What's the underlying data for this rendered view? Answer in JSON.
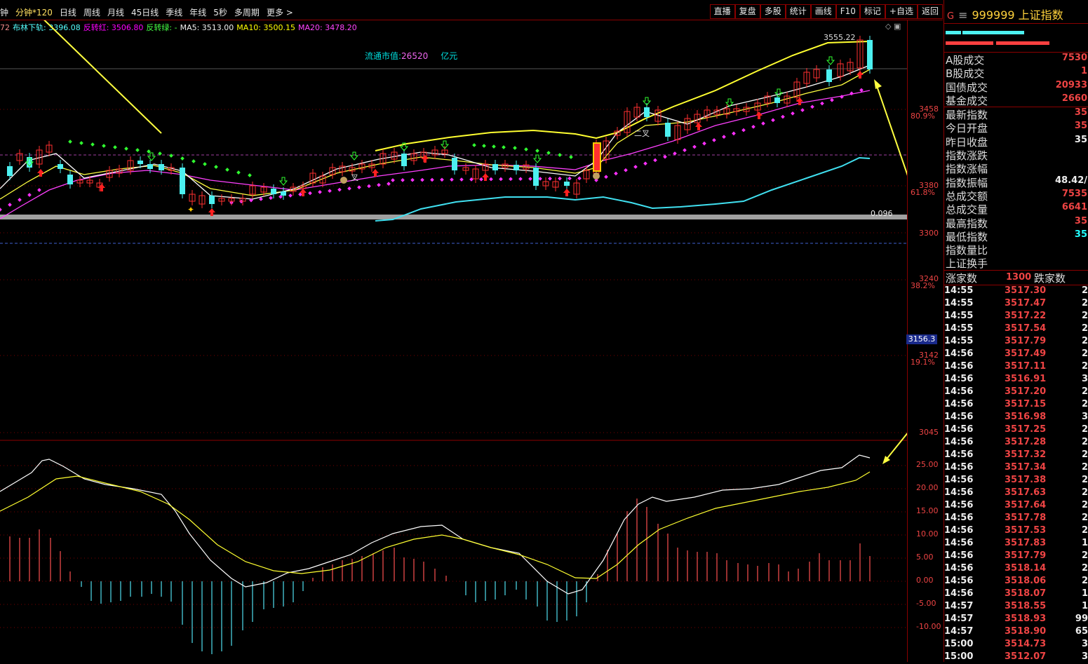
{
  "tabs": [
    {
      "label": "钟",
      "selected": false
    },
    {
      "label": "分钟*120",
      "selected": true
    },
    {
      "label": "日线",
      "selected": false
    },
    {
      "label": "周线",
      "selected": false
    },
    {
      "label": "月线",
      "selected": false
    },
    {
      "label": "45日线",
      "selected": false
    },
    {
      "label": "季线",
      "selected": false
    },
    {
      "label": "年线",
      "selected": false
    },
    {
      "label": "5秒",
      "selected": false
    },
    {
      "label": "多周期",
      "selected": false
    },
    {
      "label": "更多 >",
      "selected": false
    }
  ],
  "tools": [
    "直播",
    "复盘",
    "多股",
    "统计",
    "画线",
    "F10",
    "标记",
    "+自选",
    "返回"
  ],
  "indicators": [
    {
      "text": "72",
      "color": "#e88"
    },
    {
      "text": "布林下轨: 3396.08",
      "color": "#5ff"
    },
    {
      "text": "反转红: 3506.80",
      "color": "#f0f"
    },
    {
      "text": "反转绿: -",
      "color": "#4f4"
    },
    {
      "text": "MA5: 3513.00",
      "color": "#eee"
    },
    {
      "text": "MA10: 3500.15",
      "color": "#ff0"
    },
    {
      "text": "MA20: 3478.20",
      "color": "#f4f"
    }
  ],
  "market_cap": {
    "prefix": "流通市值:",
    "value": "26520",
    "unit": "亿元"
  },
  "chart_annotations": {
    "high_label": "3555.22",
    "bar_value": "0.096",
    "cross_label_1": "叉",
    "cross_label_2": "二叉",
    "current_price_tag": "3156.3"
  },
  "price_axis": [
    {
      "price": "3458",
      "pct": "80.9%"
    },
    {
      "price": "3380",
      "pct": "61.8%"
    },
    {
      "price": "3300",
      "pct": ""
    },
    {
      "price": "3240",
      "pct": "38.2%"
    },
    {
      "price": "3142",
      "pct": "19.1%"
    },
    {
      "price": "3045",
      "pct": ""
    }
  ],
  "macd_axis": [
    "25.00",
    "20.00",
    "15.00",
    "10.00",
    "5.00",
    "0.00",
    "-5.00",
    "-10.00"
  ],
  "panel": {
    "code_marker": "G",
    "code": "999999",
    "name": "上证指数",
    "rows": [
      {
        "label": "A股成交",
        "value": "7530",
        "color": "red"
      },
      {
        "label": "B股成交",
        "value": "1",
        "color": "red"
      },
      {
        "label": "国债成交",
        "value": "20933",
        "color": "red"
      },
      {
        "label": "基金成交",
        "value": "2660",
        "color": "red"
      },
      {
        "label": "最新指数",
        "value": "35",
        "color": "red"
      },
      {
        "label": "今日开盘",
        "value": "35",
        "color": "red"
      },
      {
        "label": "昨日收盘",
        "value": "35",
        "color": "white"
      },
      {
        "label": "指数涨跌",
        "value": "",
        "color": "red"
      },
      {
        "label": "指数涨幅",
        "value": "",
        "color": "red"
      },
      {
        "label": "指数振幅",
        "value": "48.42/",
        "color": "white"
      },
      {
        "label": "总成交额",
        "value": "7535",
        "color": "red"
      },
      {
        "label": "总成交量",
        "value": "6641",
        "color": "red"
      },
      {
        "label": "最高指数",
        "value": "35",
        "color": "red"
      },
      {
        "label": "最低指数",
        "value": "35",
        "color": "cyan"
      },
      {
        "label": "指数量比",
        "value": "",
        "color": "red"
      },
      {
        "label": "上证换手",
        "value": "",
        "color": "red"
      }
    ],
    "advdec": {
      "up_label": "涨家数",
      "up_value": "1300",
      "down_label": "跌家数"
    },
    "ticks": [
      {
        "time": "14:55",
        "price": "3517.30",
        "vol": "2"
      },
      {
        "time": "14:55",
        "price": "3517.47",
        "vol": "2"
      },
      {
        "time": "14:55",
        "price": "3517.22",
        "vol": "2"
      },
      {
        "time": "14:55",
        "price": "3517.54",
        "vol": "2"
      },
      {
        "time": "14:55",
        "price": "3517.79",
        "vol": "2"
      },
      {
        "time": "14:56",
        "price": "3517.49",
        "vol": "2"
      },
      {
        "time": "14:56",
        "price": "3517.11",
        "vol": "2"
      },
      {
        "time": "14:56",
        "price": "3516.91",
        "vol": "3"
      },
      {
        "time": "14:56",
        "price": "3517.20",
        "vol": "2"
      },
      {
        "time": "14:56",
        "price": "3517.15",
        "vol": "2"
      },
      {
        "time": "14:56",
        "price": "3516.98",
        "vol": "3"
      },
      {
        "time": "14:56",
        "price": "3517.25",
        "vol": "2"
      },
      {
        "time": "14:56",
        "price": "3517.28",
        "vol": "2"
      },
      {
        "time": "14:56",
        "price": "3517.32",
        "vol": "2"
      },
      {
        "time": "14:56",
        "price": "3517.34",
        "vol": "2"
      },
      {
        "time": "14:56",
        "price": "3517.38",
        "vol": "2"
      },
      {
        "time": "14:56",
        "price": "3517.63",
        "vol": "2"
      },
      {
        "time": "14:56",
        "price": "3517.64",
        "vol": "2"
      },
      {
        "time": "14:56",
        "price": "3517.78",
        "vol": "2"
      },
      {
        "time": "14:56",
        "price": "3517.53",
        "vol": "2"
      },
      {
        "time": "14:56",
        "price": "3517.83",
        "vol": "1"
      },
      {
        "time": "14:56",
        "price": "3517.79",
        "vol": "2"
      },
      {
        "time": "14:56",
        "price": "3518.14",
        "vol": "2"
      },
      {
        "time": "14:56",
        "price": "3518.06",
        "vol": "2"
      },
      {
        "time": "14:56",
        "price": "3518.07",
        "vol": "1"
      },
      {
        "time": "14:57",
        "price": "3518.55",
        "vol": "1"
      },
      {
        "time": "14:57",
        "price": "3518.93",
        "vol": "99"
      },
      {
        "time": "14:57",
        "price": "3518.90",
        "vol": "65"
      },
      {
        "time": "15:00",
        "price": "3514.73",
        "vol": "3"
      },
      {
        "time": "15:00",
        "price": "3512.07",
        "vol": "3"
      }
    ]
  },
  "colors": {
    "up": "#ff3030",
    "down": "#4cf0f0",
    "ma5": "#ffffff",
    "ma10": "#ffff40",
    "ma20": "#ff40ff",
    "boll_upper": "#ffff30",
    "boll_lower": "#40e0f0",
    "green_dot": "#30ff30",
    "pink_dot": "#ff30ff",
    "frame": "#8b0000"
  }
}
